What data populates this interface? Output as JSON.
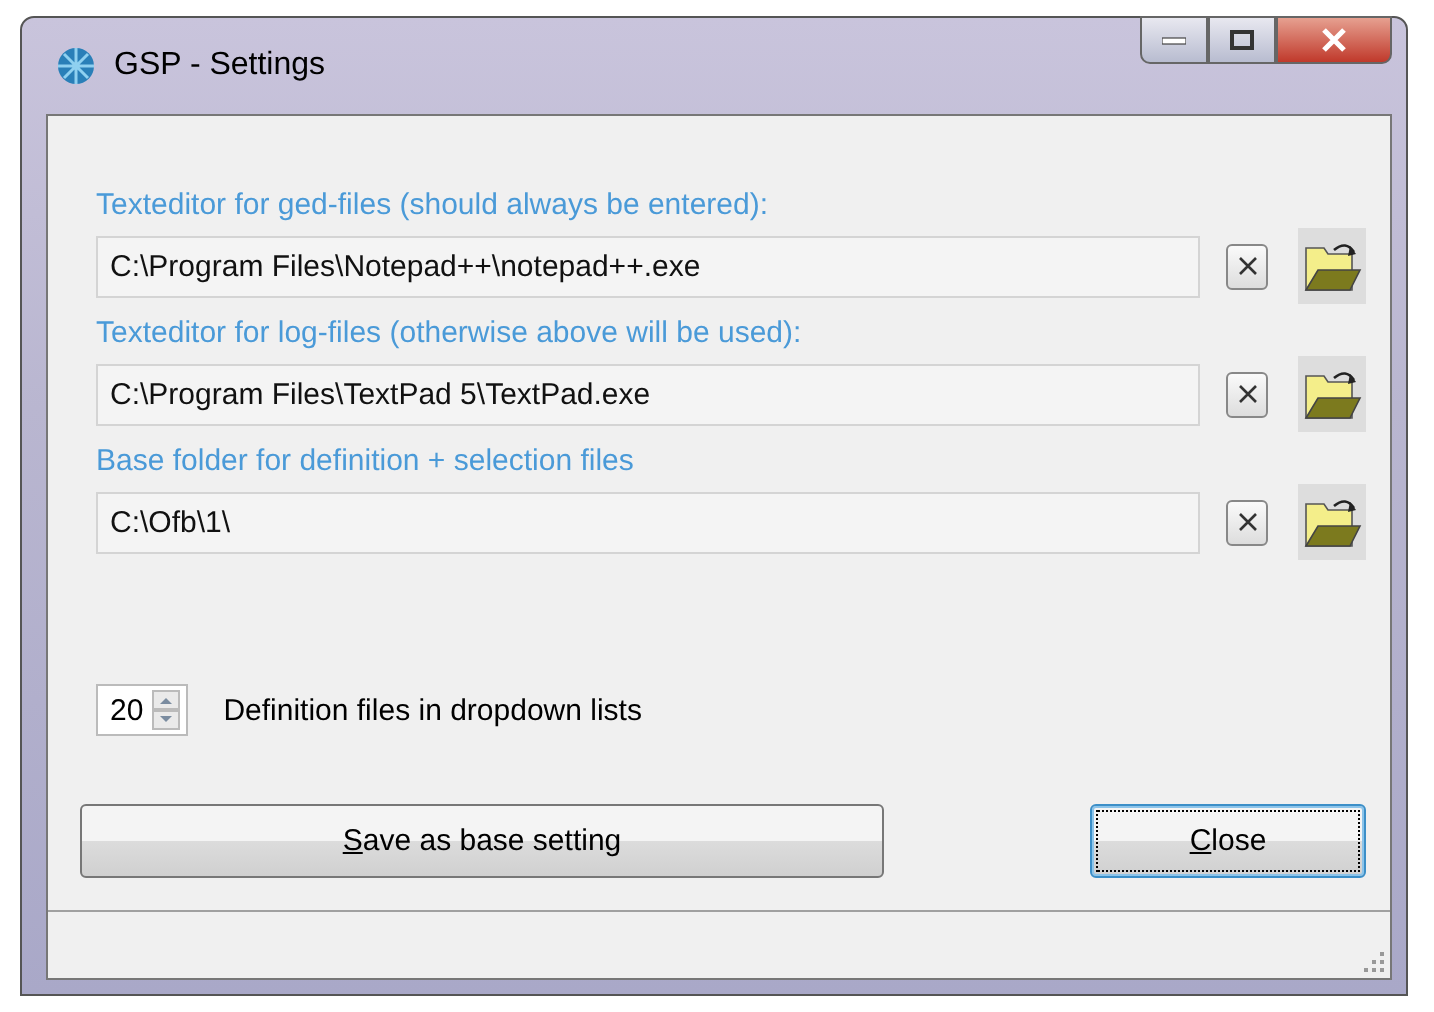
{
  "window": {
    "title": "GSP - Settings"
  },
  "path_fields": [
    {
      "label": "Texteditor for ged-files (should always be entered):",
      "value": "C:\\Program Files\\Notepad++\\notepad++.exe"
    },
    {
      "label": "Texteditor for log-files (otherwise above will be used):",
      "value": "C:\\Program Files\\TextPad 5\\TextPad.exe"
    },
    {
      "label": "Base folder for definition + selection files",
      "value": "C:\\Ofb\\1\\"
    }
  ],
  "spinner": {
    "value": "20",
    "label": "Definition files in dropdown lists"
  },
  "buttons": [
    {
      "label": "Save as base setting",
      "underline_first": true,
      "focused": false,
      "kind": "wide"
    },
    {
      "label": "Close",
      "underline_first": true,
      "focused": true,
      "kind": "narrow"
    }
  ]
}
